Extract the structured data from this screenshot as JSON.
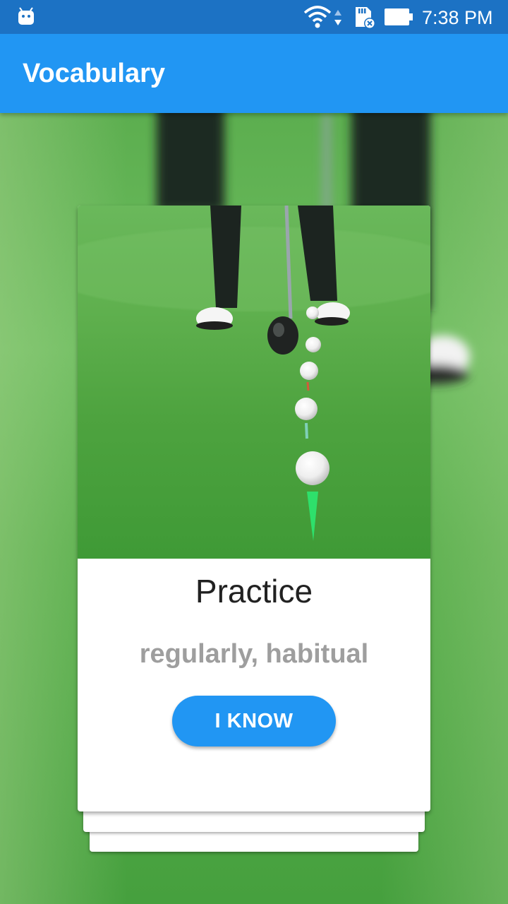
{
  "status_bar": {
    "time": "7:38 PM",
    "icons": [
      "android-icon",
      "wifi-icon",
      "data-activity-icon",
      "sd-card-icon",
      "battery-icon"
    ]
  },
  "app_bar": {
    "title": "Vocabulary",
    "color": "#2196F3"
  },
  "card": {
    "image": "golf-putting-photo",
    "word": "Practice",
    "meaning": "regularly, habitual",
    "button_label": "I KNOW"
  },
  "colors": {
    "status_bar": "#1C72C4",
    "accent": "#2196F3",
    "word_text": "#212121",
    "meaning_text": "#9E9E9E",
    "grass": "#4FA84A"
  }
}
